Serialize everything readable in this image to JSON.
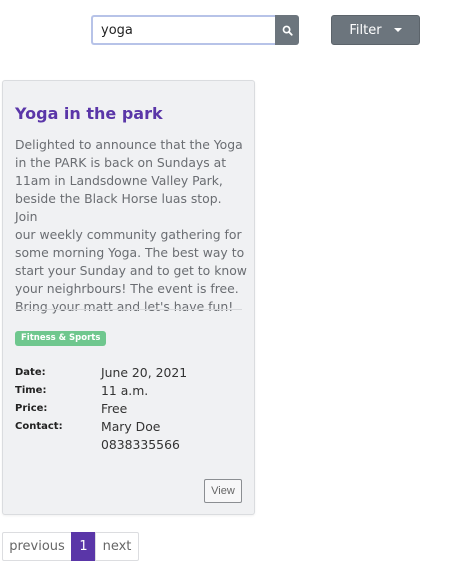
{
  "search": {
    "value": "yoga",
    "placeholder": ""
  },
  "filter": {
    "label": "Filter"
  },
  "event": {
    "title": "Yoga in the park",
    "description": [
      "Delighted to announce that the Yoga",
      "in the PARK is back on Sundays at",
      "11am in Landsdowne Valley Park,",
      "beside the Black Horse luas stop. Join",
      "our weekly community gathering for",
      "some morning Yoga. The best way to",
      "start your Sunday and to get to know",
      "your neighrbours! The event is free.",
      "Bring your matt and let's have fun!"
    ],
    "category": "Fitness & Sports",
    "date_label": "Date:",
    "date": "June 20, 2021",
    "time_label": "Time:",
    "time": "11 a.m.",
    "price_label": "Price:",
    "price": "Free",
    "contact_label": "Contact:",
    "contact_name": "Mary Doe",
    "contact_phone": "0838335566",
    "view_label": "View"
  },
  "pagination": {
    "previous": "previous",
    "current": "1",
    "next": "next"
  },
  "colors": {
    "accent": "#5a36a8",
    "tag": "#6fc78e",
    "button": "#6c757d"
  },
  "icons": {
    "search": "search-icon",
    "dropdown": "caret-down-icon"
  }
}
